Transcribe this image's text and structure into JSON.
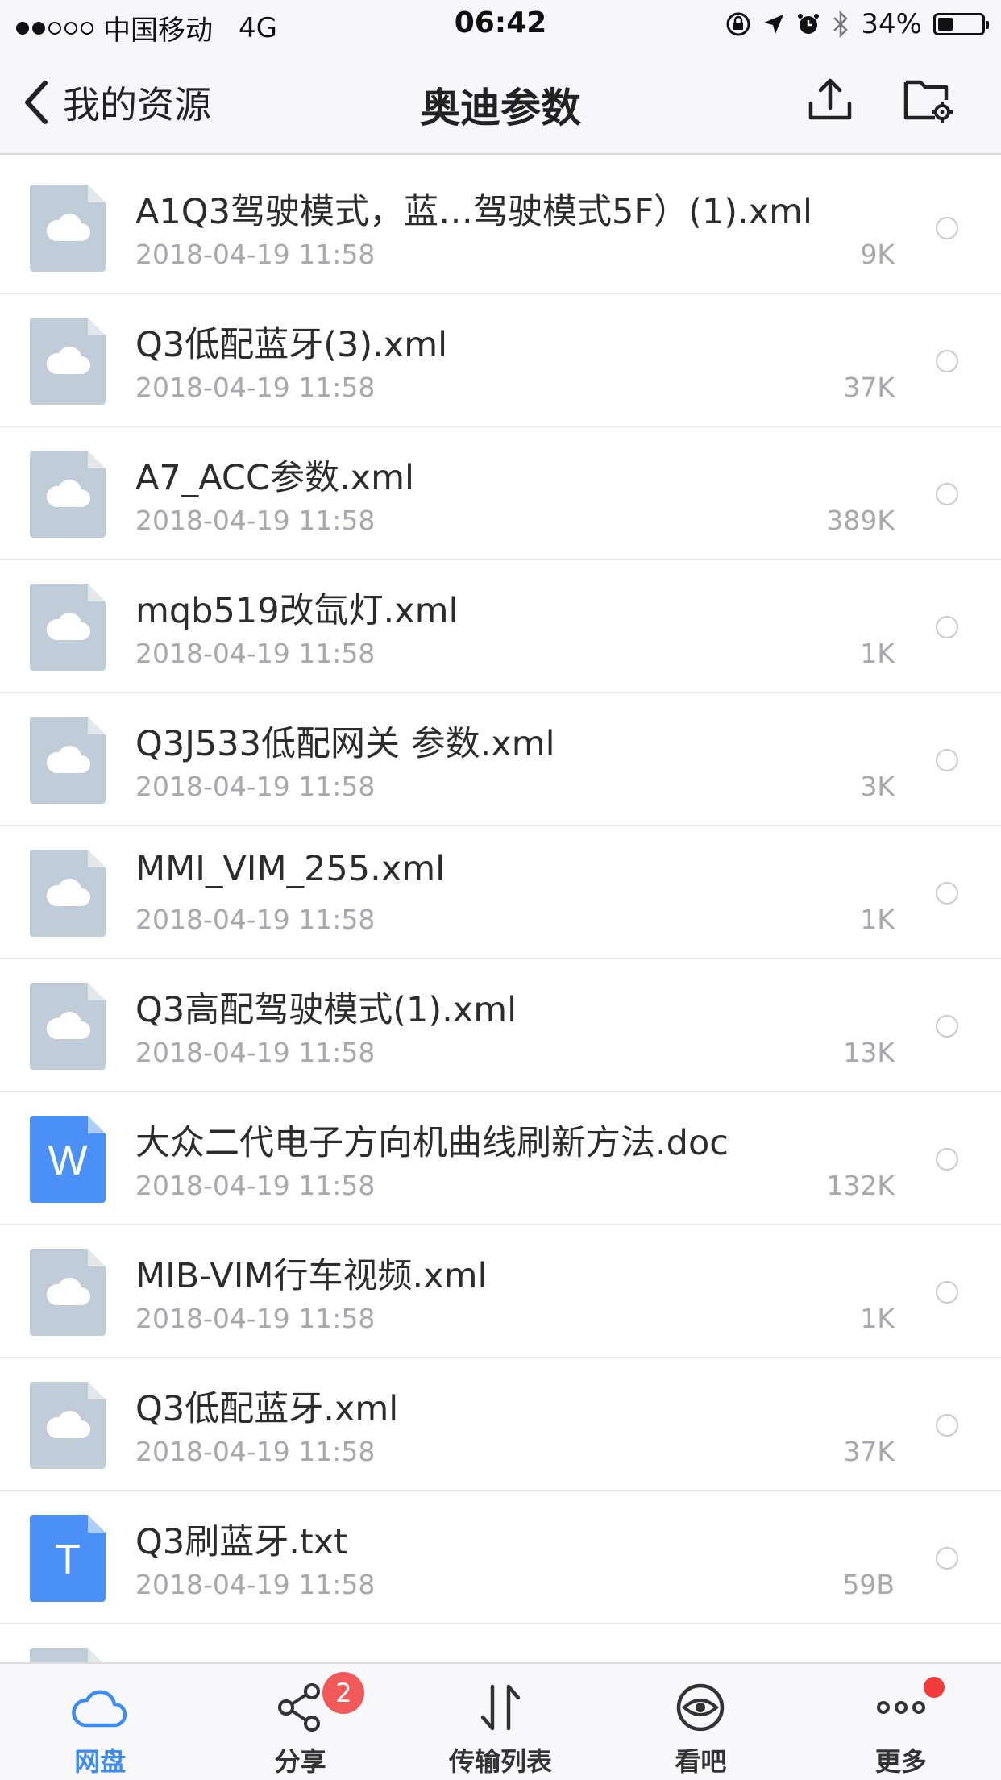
{
  "status_bar": {
    "carrier": "中国移动",
    "network": "4G",
    "time": "06:42",
    "battery": "34%",
    "battery_level": 0.34
  },
  "nav": {
    "back_label": "我的资源",
    "title": "奥迪参数"
  },
  "files": [
    {
      "name": "A1Q3驾驶模式，蓝…驾驶模式5F）(1).xml",
      "date": "2018-04-19 11:58",
      "size": "9K",
      "type": "cloud-file-icon"
    },
    {
      "name": "Q3低配蓝牙(3).xml",
      "date": "2018-04-19 11:58",
      "size": "37K",
      "type": "cloud-file-icon"
    },
    {
      "name": "A7_ACC参数.xml",
      "date": "2018-04-19 11:58",
      "size": "389K",
      "type": "cloud-file-icon"
    },
    {
      "name": "mqb519改氙灯.xml",
      "date": "2018-04-19 11:58",
      "size": "1K",
      "type": "cloud-file-icon"
    },
    {
      "name": "Q3J533低配网关 参数.xml",
      "date": "2018-04-19 11:58",
      "size": "3K",
      "type": "cloud-file-icon"
    },
    {
      "name": "MMI_VIM_255.xml",
      "date": "2018-04-19 11:58",
      "size": "1K",
      "type": "cloud-file-icon"
    },
    {
      "name": "Q3高配驾驶模式(1).xml",
      "date": "2018-04-19 11:58",
      "size": "13K",
      "type": "cloud-file-icon"
    },
    {
      "name": "大众二代电子方向机曲线刷新方法.doc",
      "date": "2018-04-19 11:58",
      "size": "132K",
      "type": "word-file-icon",
      "letter": "W"
    },
    {
      "name": "MIB-VIM行车视频.xml",
      "date": "2018-04-19 11:58",
      "size": "1K",
      "type": "cloud-file-icon"
    },
    {
      "name": "Q3低配蓝牙.xml",
      "date": "2018-04-19 11:58",
      "size": "37K",
      "type": "cloud-file-icon"
    },
    {
      "name": "Q3刷蓝牙.txt",
      "date": "2018-04-19 11:58",
      "size": "59B",
      "type": "text-file-icon",
      "letter": "T"
    }
  ],
  "tabs": [
    {
      "label": "网盘",
      "icon": "cloud-icon",
      "active": true
    },
    {
      "label": "分享",
      "icon": "share-icon",
      "badge": "2"
    },
    {
      "label": "传输列表",
      "icon": "transfer-icon"
    },
    {
      "label": "看吧",
      "icon": "eye-icon"
    },
    {
      "label": "更多",
      "icon": "more-icon",
      "dot": true
    }
  ],
  "colors": {
    "accent": "#3b8cf5",
    "file_icon_gray": "#c0ccd8",
    "file_icon_blue": "#4a90f7",
    "badge_red": "#f25a5a"
  }
}
